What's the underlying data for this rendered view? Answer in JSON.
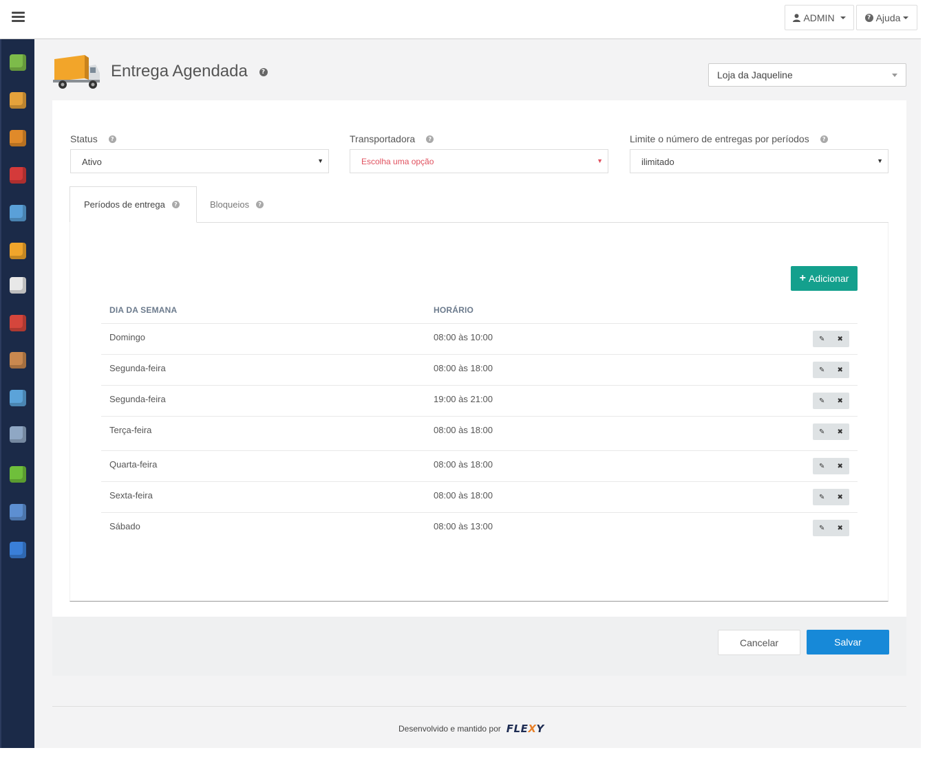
{
  "topbar": {
    "user_label": "ADMIN",
    "help_label": "Ajuda"
  },
  "sidebar": {
    "items": [
      {
        "icon": "database-cube-icon",
        "color": "#7dbb4a"
      },
      {
        "icon": "store-icon",
        "color": "#e5a23b"
      },
      {
        "icon": "box-icon",
        "color": "#e08a2a"
      },
      {
        "icon": "discount-icon",
        "color": "#d43a3a"
      },
      {
        "icon": "window-chart-icon",
        "color": "#5aa0d8"
      },
      {
        "icon": "truck-icon",
        "color": "#f0a52b"
      },
      {
        "icon": "document-icon",
        "color": "#e8e8e8"
      },
      {
        "icon": "users-icon",
        "color": "#d5463c"
      },
      {
        "icon": "user-icon",
        "color": "#c9884f"
      },
      {
        "icon": "image-icon",
        "color": "#5ba3d9"
      },
      {
        "icon": "database-user-icon",
        "color": "#8fa7c4"
      },
      {
        "icon": "bar-chart-icon",
        "color": "#6fbf3b"
      },
      {
        "icon": "monitor-settings-icon",
        "color": "#5d8fd1"
      },
      {
        "icon": "help-book-icon",
        "color": "#3a7fd8"
      }
    ]
  },
  "page": {
    "title": "Entrega Agendada",
    "store": "Loja da Jaqueline"
  },
  "form": {
    "status_label": "Status",
    "status_value": "Ativo",
    "carrier_label": "Transportadora",
    "carrier_value": "Escolha uma opção",
    "limit_label": "Limite o número de entregas por períodos",
    "limit_value": "ilimitado"
  },
  "tabs": [
    {
      "label": "Períodos de entrega",
      "active": true
    },
    {
      "label": "Bloqueios",
      "active": false
    }
  ],
  "table": {
    "add_label": "Adicionar",
    "columns": [
      "DIA DA SEMANA",
      "HORÁRIO"
    ],
    "rows": [
      {
        "day": "Domingo",
        "time": "08:00 às 10:00"
      },
      {
        "day": "Segunda-feira",
        "time": "08:00 às 18:00"
      },
      {
        "day": "Segunda-feira",
        "time": "19:00 às 21:00"
      },
      {
        "day": "Terça-feira",
        "time": "08:00 às 18:00"
      },
      {
        "day": "Quarta-feira",
        "time": "08:00 às 18:00"
      },
      {
        "day": "Sexta-feira",
        "time": "08:00 às 18:00"
      },
      {
        "day": "Sábado",
        "time": "08:00 às 13:00"
      }
    ]
  },
  "actions": {
    "cancel_label": "Cancelar",
    "save_label": "Salvar"
  },
  "footer": {
    "text": "Desenvolvido e mantido por",
    "brand_prefix": "FLE",
    "brand_x": "X",
    "brand_suffix": "Y"
  },
  "colors": {
    "sidebar_bg": "#1b2a48",
    "add_button": "#14a08d",
    "save_button": "#1789d8",
    "invalid_text": "#e0505e"
  }
}
